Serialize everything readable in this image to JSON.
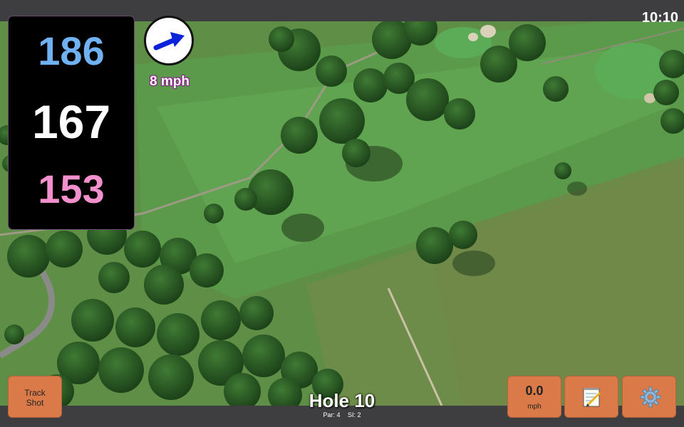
{
  "status_bar": {
    "time": "10:10"
  },
  "distances": {
    "back": "186",
    "middle": "167",
    "front": "153"
  },
  "wind": {
    "speed_text": "8 mph",
    "direction_icon": "wind-arrow-icon"
  },
  "controls": {
    "track_shot": {
      "line1": "Track",
      "line2": "Shot"
    },
    "speed": {
      "value": "0.0",
      "unit": "mph"
    },
    "notes_icon": "notepad-icon",
    "settings_icon": "gear-icon"
  },
  "hole": {
    "title": "Hole 10",
    "par": "Par: 4",
    "si": "SI: 2"
  },
  "colors": {
    "back": "#6fb1f1",
    "middle": "#ffffff",
    "front": "#f28fcd",
    "button": "#d97a48",
    "bar": "#3e3e40"
  }
}
